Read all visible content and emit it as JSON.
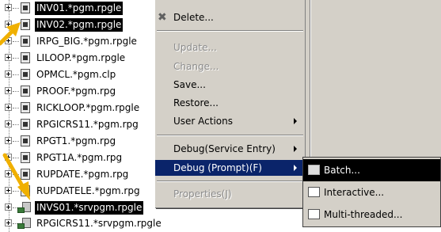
{
  "tree": {
    "items": [
      {
        "label": "INV01.*pgm.rpgle",
        "selected": true,
        "icon": "program-file-icon"
      },
      {
        "label": "INV02.*pgm.rpgle",
        "selected": true,
        "icon": "program-file-icon"
      },
      {
        "label": "IRPG_BIG.*pgm.rpgle",
        "selected": false,
        "icon": "program-file-icon"
      },
      {
        "label": "LILOOP.*pgm.rpgle",
        "selected": false,
        "icon": "program-file-icon"
      },
      {
        "label": "OPMCL.*pgm.clp",
        "selected": false,
        "icon": "program-file-icon"
      },
      {
        "label": "PROOF.*pgm.rpg",
        "selected": false,
        "icon": "program-file-icon"
      },
      {
        "label": "RICKLOOP.*pgm.rpgle",
        "selected": false,
        "icon": "program-file-icon"
      },
      {
        "label": "RPGICRS11.*pgm.rpg",
        "selected": false,
        "icon": "program-file-icon"
      },
      {
        "label": "RPGT1.*pgm.rpg",
        "selected": false,
        "icon": "program-file-icon"
      },
      {
        "label": "RPGT1A.*pgm.rpg",
        "selected": false,
        "icon": "program-file-icon"
      },
      {
        "label": "RUPDATE.*pgm.rpg",
        "selected": false,
        "icon": "program-file-icon"
      },
      {
        "label": "RUPDATELE.*pgm.rpg",
        "selected": false,
        "icon": "program-file-icon"
      },
      {
        "label": "INVS01.*srvpgm.rpgle",
        "selected": true,
        "icon": "service-program-icon"
      },
      {
        "label": "RPGICRS11.*srvpgm.rpgle",
        "selected": false,
        "icon": "service-program-icon"
      }
    ]
  },
  "context_menu": {
    "items": [
      {
        "label": "Delete...",
        "enabled": true,
        "icon": "delete-x-icon",
        "submenu": false
      },
      {
        "label": "Update...",
        "enabled": false,
        "submenu": false
      },
      {
        "label": "Change...",
        "enabled": false,
        "submenu": false
      },
      {
        "label": "Save...",
        "enabled": true,
        "submenu": false
      },
      {
        "label": "Restore...",
        "enabled": true,
        "submenu": false
      },
      {
        "label": "User Actions",
        "enabled": true,
        "submenu": true
      },
      {
        "label": "Debug(Service Entry)",
        "enabled": true,
        "submenu": true
      },
      {
        "label": "Debug (Prompt)(F)",
        "enabled": true,
        "submenu": true,
        "highlighted": true
      },
      {
        "label": "Properties(J)",
        "enabled": false,
        "submenu": false
      }
    ]
  },
  "debug_submenu": {
    "items": [
      {
        "label": "Batch...",
        "icon": "batch-debug-icon",
        "highlighted": true
      },
      {
        "label": "Interactive...",
        "icon": "interactive-debug-icon",
        "highlighted": false
      },
      {
        "label": "Multi-threaded...",
        "icon": "multithreaded-debug-icon",
        "highlighted": false
      }
    ]
  },
  "colors": {
    "menu_background": "#d4d0c8",
    "menu_highlight": "#0a246a",
    "selection": "#000000",
    "annotation_arrow": "#f0b000"
  }
}
